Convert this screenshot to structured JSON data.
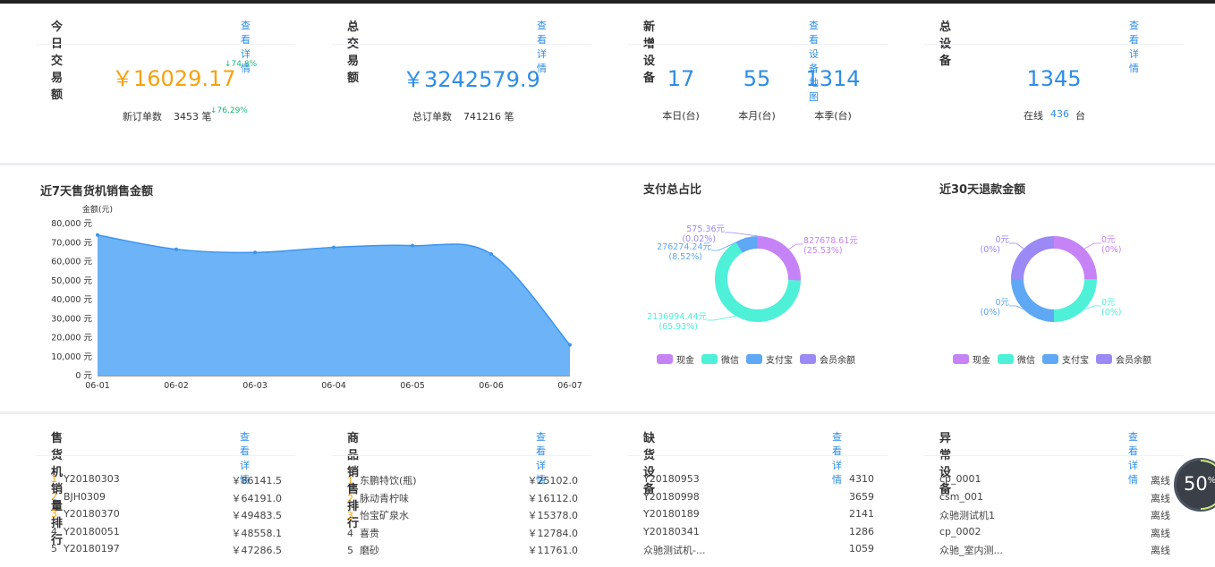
{
  "cards": {
    "today": {
      "title": "今日交易额",
      "link": "查看详情",
      "amount": "￥16029.17",
      "amount_change": "↓74.8%",
      "orders_label": "新订单数",
      "orders_value": "3453 笔",
      "orders_change": "↓76.29%"
    },
    "total": {
      "title": "总交易额",
      "link": "查看详情",
      "amount": "￥3242579.9",
      "orders_label": "总订单数",
      "orders_value": "741216 笔"
    },
    "new_devices": {
      "title": "新增设备",
      "link": "查看设备地图",
      "stats": [
        {
          "value": "17",
          "label": "本日(台)"
        },
        {
          "value": "55",
          "label": "本月(台)"
        },
        {
          "value": "1314",
          "label": "本季(台)"
        }
      ]
    },
    "all_devices": {
      "title": "总设备",
      "link": "查看详情",
      "value": "1345",
      "online_label": "在线",
      "online_value": "436",
      "online_unit": "台"
    }
  },
  "sales_chart": {
    "title": "近7天售货机销售金额",
    "chart_data": {
      "type": "area",
      "ylabel": "金额(元)",
      "ylim": [
        0,
        80000
      ],
      "ytick_labels": [
        "0 元",
        "10,000 元",
        "20,000 元",
        "30,000 元",
        "40,000 元",
        "50,000 元",
        "60,000 元",
        "70,000 元",
        "80,000 元"
      ],
      "categories": [
        "06-01",
        "06-02",
        "06-03",
        "06-04",
        "06-05",
        "06-06",
        "06-07"
      ],
      "values": [
        74000,
        66500,
        64800,
        67500,
        68400,
        64000,
        16200
      ],
      "color": "#6cb3f7"
    }
  },
  "payment_ratio": {
    "title": "支付总占比",
    "chart_data": {
      "type": "pie",
      "slices": [
        {
          "name": "现金",
          "value": 827678.61,
          "label_value": "827678.61元",
          "label_pct": "(25.53%)",
          "color": "#c683f6"
        },
        {
          "name": "微信",
          "value": 2136994.44,
          "label_value": "2136994.44元",
          "label_pct": "(65.93%)",
          "color": "#4ef0d8"
        },
        {
          "name": "支付宝",
          "value": 276274.24,
          "label_value": "276274.24元",
          "label_pct": "(8.52%)",
          "color": "#5fa8f6"
        },
        {
          "name": "会员余额",
          "value": 575.36,
          "label_value": "575.36元",
          "label_pct": "(0.02%)",
          "color": "#9b8af5"
        }
      ]
    }
  },
  "refund_ratio": {
    "title": "近30天退款金额",
    "chart_data": {
      "type": "pie",
      "slices": [
        {
          "name": "现金",
          "value": 0,
          "label_value": "0元",
          "label_pct": "(0%)",
          "color": "#c683f6"
        },
        {
          "name": "微信",
          "value": 0,
          "label_value": "0元",
          "label_pct": "(0%)",
          "color": "#4ef0d8"
        },
        {
          "name": "支付宝",
          "value": 0,
          "label_value": "0元",
          "label_pct": "(0%)",
          "color": "#5fa8f6"
        },
        {
          "name": "会员余额",
          "value": 0,
          "label_value": "0元",
          "label_pct": "(0%)",
          "color": "#9b8af5"
        }
      ]
    }
  },
  "legend_items": [
    "现金",
    "微信",
    "支付宝",
    "会员余额"
  ],
  "lists": {
    "machine_rank": {
      "title": "售货机销量排行",
      "link": "查看详情",
      "rows": [
        {
          "no": "1",
          "name": "Y20180303",
          "value": "￥86141.5"
        },
        {
          "no": "2",
          "name": "BJH0309",
          "value": "￥64191.0"
        },
        {
          "no": "3",
          "name": "Y20180370",
          "value": "￥49483.5"
        },
        {
          "no": "4",
          "name": "Y20180051",
          "value": "￥48558.1"
        },
        {
          "no": "5",
          "name": "Y20180197",
          "value": "￥47286.5"
        }
      ]
    },
    "product_rank": {
      "title": "商品销售排行",
      "link": "查看详情",
      "rows": [
        {
          "no": "1",
          "name": "东鹏特饮(瓶)",
          "value": "￥25102.0"
        },
        {
          "no": "2",
          "name": "脉动青柠味",
          "value": "￥16112.0"
        },
        {
          "no": "3",
          "name": "怡宝矿泉水",
          "value": "￥15378.0"
        },
        {
          "no": "4",
          "name": "喜贵",
          "value": "￥12784.0"
        },
        {
          "no": "5",
          "name": "磨砂",
          "value": "￥11761.0"
        }
      ]
    },
    "out_of_stock": {
      "title": "缺货设备",
      "link": "查看详情",
      "rows": [
        {
          "name": "Y20180953",
          "value": "4310"
        },
        {
          "name": "Y20180998",
          "value": "3659"
        },
        {
          "name": "Y20180189",
          "value": "2141"
        },
        {
          "name": "Y20180341",
          "value": "1286"
        },
        {
          "name": "众驰测试机-...",
          "value": "1059"
        }
      ]
    },
    "abnormal": {
      "title": "异常设备",
      "link": "查看详情",
      "rows": [
        {
          "name": "cp_0001",
          "value": "离线"
        },
        {
          "name": "csm_001",
          "value": "离线"
        },
        {
          "name": "众驰测试机1",
          "value": "离线"
        },
        {
          "name": "cp_0002",
          "value": "离线"
        },
        {
          "name": "众驰_室内测...",
          "value": "离线"
        }
      ]
    }
  },
  "progress_badge": {
    "value": "50",
    "unit": "%",
    "fraction": 0.5
  }
}
